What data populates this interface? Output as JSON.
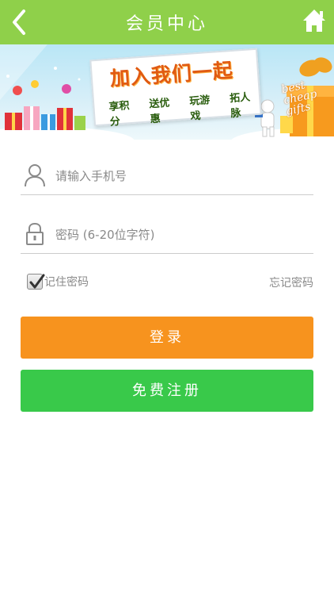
{
  "header": {
    "title": "会员中心",
    "back_icon": "chevron-left-icon",
    "home_icon": "home-icon",
    "background": "#8fd04a"
  },
  "banner": {
    "headline": "加入我们一起",
    "items": [
      "享积分",
      "送优惠",
      "玩游戏",
      "拓人脉"
    ],
    "gift_text": "best cheap gifts"
  },
  "form": {
    "phone": {
      "placeholder": "请输入手机号",
      "value": "",
      "icon": "user-icon"
    },
    "password": {
      "placeholder": "密码 (6-20位字符)",
      "value": "",
      "icon": "lock-icon"
    },
    "remember_label": "记住密码",
    "remember_checked": true,
    "forgot_label": "忘记密码"
  },
  "buttons": {
    "login_label": "登录",
    "login_color": "#f7931e",
    "register_label": "免费注册",
    "register_color": "#39c94a"
  }
}
